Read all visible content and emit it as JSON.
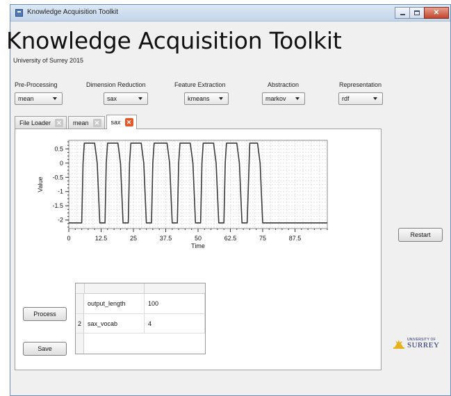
{
  "window": {
    "title": "Knowledge Acquisition Toolkit",
    "controls": {
      "minimize_icon": "minimize-icon",
      "maximize_icon": "maximize-icon",
      "close_label": "✕"
    }
  },
  "header": {
    "title": "Knowledge Acquisition Toolkit",
    "subtitle": "University of Surrey 2015"
  },
  "pipeline": [
    {
      "label": "Pre-Processing",
      "value": "mean"
    },
    {
      "label": "Dimension Reduction",
      "value": "sax"
    },
    {
      "label": "Feature Extraction",
      "value": "kmeans"
    },
    {
      "label": "Abstraction",
      "value": "markov"
    },
    {
      "label": "Representation",
      "value": "rdf"
    }
  ],
  "tabs": [
    {
      "label": "File Loader",
      "active": false
    },
    {
      "label": "mean",
      "active": false
    },
    {
      "label": "sax",
      "active": true
    }
  ],
  "chart_data": {
    "type": "line",
    "xlabel": "Time",
    "ylabel": "Value",
    "xlim": [
      0,
      100
    ],
    "ylim": [
      -2.3,
      0.8
    ],
    "x_ticks": [
      0,
      12.5,
      25,
      37.5,
      50,
      62.5,
      75,
      87.5
    ],
    "x_tick_labels": [
      "0",
      "12.5",
      "25",
      "37.5",
      "50",
      "62.5",
      "75",
      "87.5"
    ],
    "y_ticks": [
      0.5,
      0,
      -0.5,
      -1,
      -1.5,
      -2
    ],
    "y_tick_labels": [
      "0.5",
      "0",
      "-0.5",
      "-1",
      "-1.5",
      "-2"
    ],
    "grid": true,
    "series": [
      {
        "color": "#3a3a3a",
        "x": [
          0,
          3,
          5,
          5.5,
          6,
          10,
          11,
          12,
          14,
          14.5,
          15,
          19,
          20,
          21,
          23,
          23.5,
          24,
          28,
          29,
          30,
          32,
          32.5,
          33,
          38,
          39,
          40,
          42,
          42.5,
          43,
          47,
          48,
          49,
          51,
          51.5,
          52,
          56,
          57,
          58,
          60,
          60.5,
          61,
          65,
          66,
          67,
          69,
          70,
          71,
          73,
          74,
          75,
          77,
          78,
          100
        ],
        "y": [
          -2.1,
          -2.1,
          -2.1,
          0,
          0.7,
          0.7,
          0,
          -2.1,
          -2.1,
          0,
          0.7,
          0.7,
          0,
          -2.1,
          -2.1,
          0,
          0.7,
          0.7,
          0,
          -2.1,
          -2.1,
          0,
          0.7,
          0.7,
          0,
          -2.1,
          -2.1,
          0,
          0.7,
          0.7,
          0,
          -2.1,
          -2.1,
          0,
          0.7,
          0.7,
          0,
          -2.1,
          -2.1,
          0,
          0.7,
          0.7,
          0,
          -2.1,
          -2.1,
          0.7,
          0.7,
          0.7,
          0,
          -2.1,
          -2.1,
          -2.1,
          -2.1
        ]
      }
    ]
  },
  "buttons": {
    "restart": "Restart",
    "process": "Process",
    "save": "Save"
  },
  "params_table": {
    "rows": [
      {
        "index": "",
        "key": "output_length",
        "value": "100"
      },
      {
        "index": "2",
        "key": "sax_vocab",
        "value": "4"
      }
    ]
  },
  "logo": {
    "top": "UNIVERSITY OF",
    "main": "SURREY",
    "seal_color": "#e8b21e"
  }
}
